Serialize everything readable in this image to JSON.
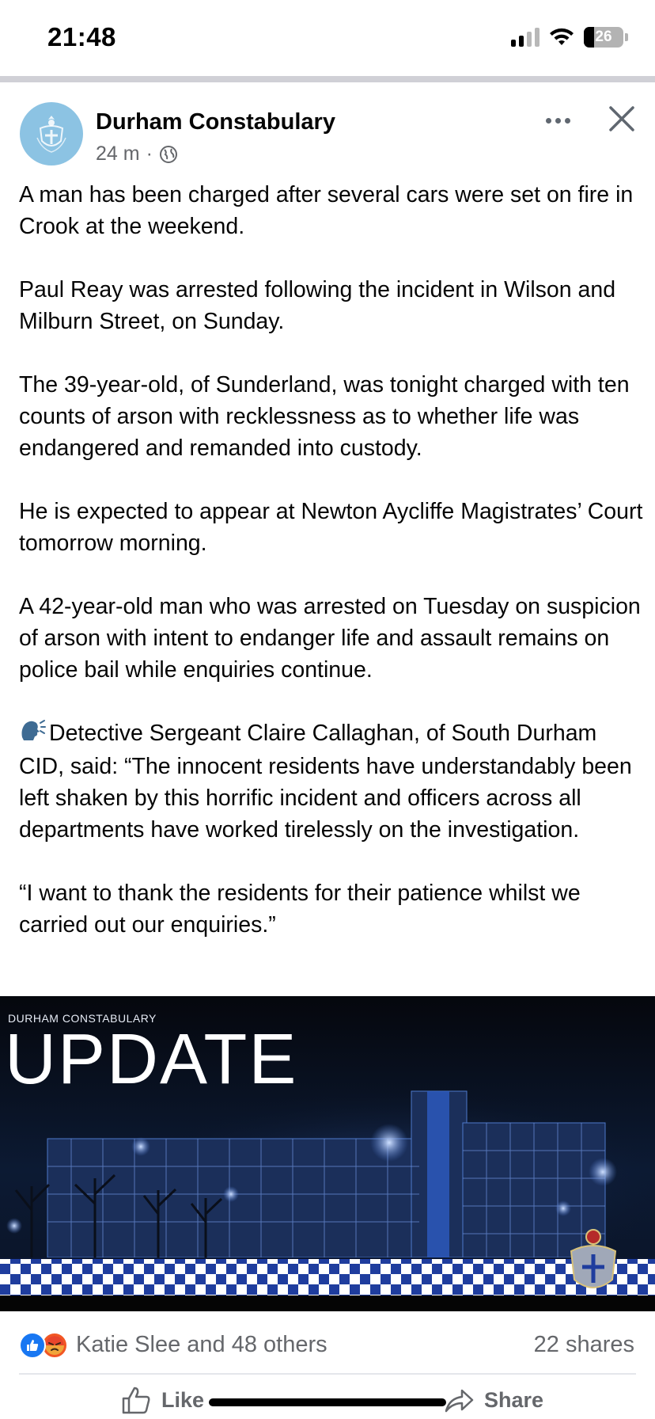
{
  "status_bar": {
    "time": "21:48",
    "battery": "26",
    "icons": [
      "signal-icon",
      "wifi-icon",
      "battery-icon"
    ]
  },
  "post": {
    "author": "Durham Constabulary",
    "time_ago": "24 m",
    "separator": "·",
    "audience_icon": "globe-icon",
    "paragraphs": [
      "A man has been charged after several cars were set on fire in Crook at the weekend.",
      "Paul Reay was arrested following the incident in Wilson and Milburn Street, on Sunday.",
      "The 39-year-old, of Sunderland, was tonight charged with ten counts of arson with recklessness as to whether life was endangered and remanded into custody.",
      "He is expected to appear at Newton Aycliffe Magistrates’ Court tomorrow morning.",
      "A 42-year-old man who was arrested on Tuesday on suspicion of arson with intent to endanger life and assault remains on police bail while enquiries continue.",
      "Detective Sergeant Claire Callaghan, of South Durham CID, said: “The innocent residents have understandably been left shaken by this horrific incident and officers across all departments have worked tirelessly on the investigation.",
      "“I want to thank the residents for their patience whilst we carried out our enquiries.”"
    ],
    "speaking_icon": "speaking-head-icon"
  },
  "image": {
    "kicker": "DURHAM CONSTABULARY",
    "headline": "UPDATE"
  },
  "reactions": {
    "icons": [
      "like-reaction-icon",
      "angry-reaction-icon"
    ],
    "summary": "Katie Slee and 48 others",
    "shares": "22 shares"
  },
  "actions": {
    "like": "Like",
    "share": "Share"
  },
  "colors": {
    "facebook_blue": "#1877f2",
    "secondary_text": "#65676b",
    "avatar_bg": "#8cc3e3"
  }
}
